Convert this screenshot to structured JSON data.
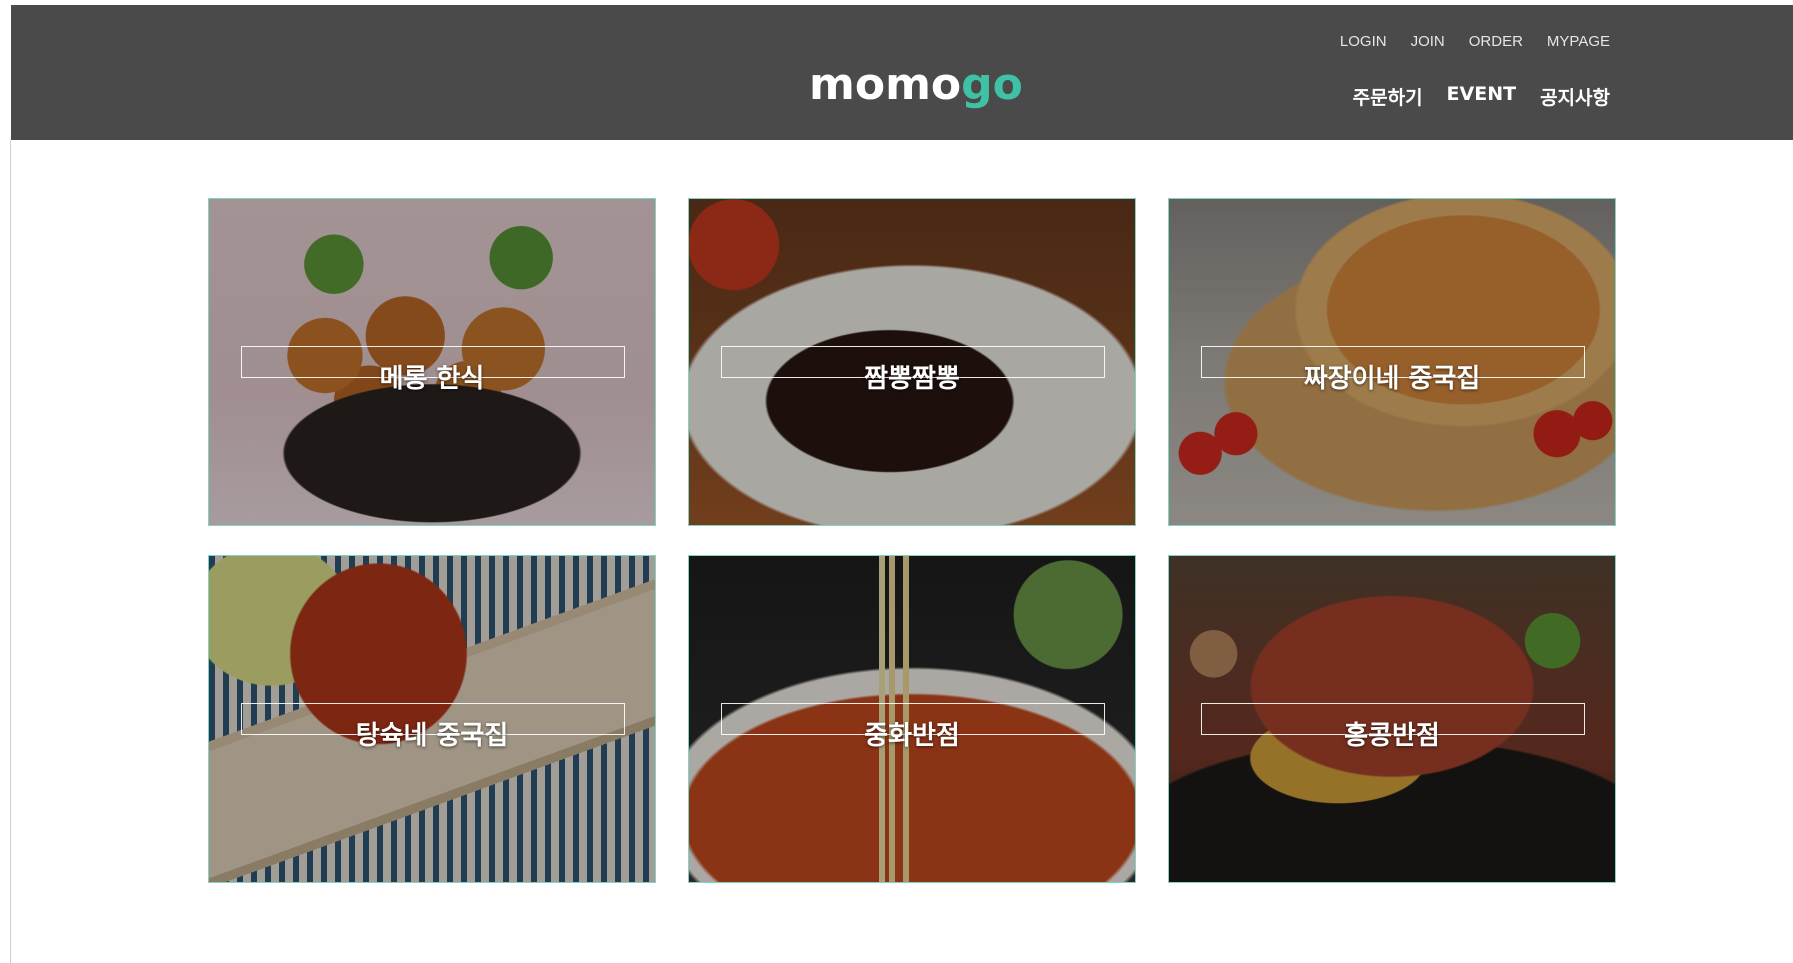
{
  "header": {
    "logo": {
      "part1": "momo",
      "part2": "go"
    },
    "util_nav": [
      "LOGIN",
      "JOIN",
      "ORDER",
      "MYPAGE"
    ],
    "main_nav": [
      "주문하기",
      "EVENT",
      "공지사항"
    ]
  },
  "restaurants": [
    {
      "name": "메롱 한식",
      "image": "fried-chicken-basket"
    },
    {
      "name": "짬뽕짬뽕",
      "image": "jjajangmyeon-bowl"
    },
    {
      "name": "짜장이네 중국집",
      "image": "pizza-with-tomatoes"
    },
    {
      "name": "탕슉네 중국집",
      "image": "bossam-pork-kimchi"
    },
    {
      "name": "중화반점",
      "image": "ramen-noodles"
    },
    {
      "name": "홍콩반점",
      "image": "braised-jjim-dish"
    }
  ],
  "colors": {
    "header_bg": "#4a4a4a",
    "accent": "#3fc1a5",
    "card_border": "#7fd3c1"
  }
}
